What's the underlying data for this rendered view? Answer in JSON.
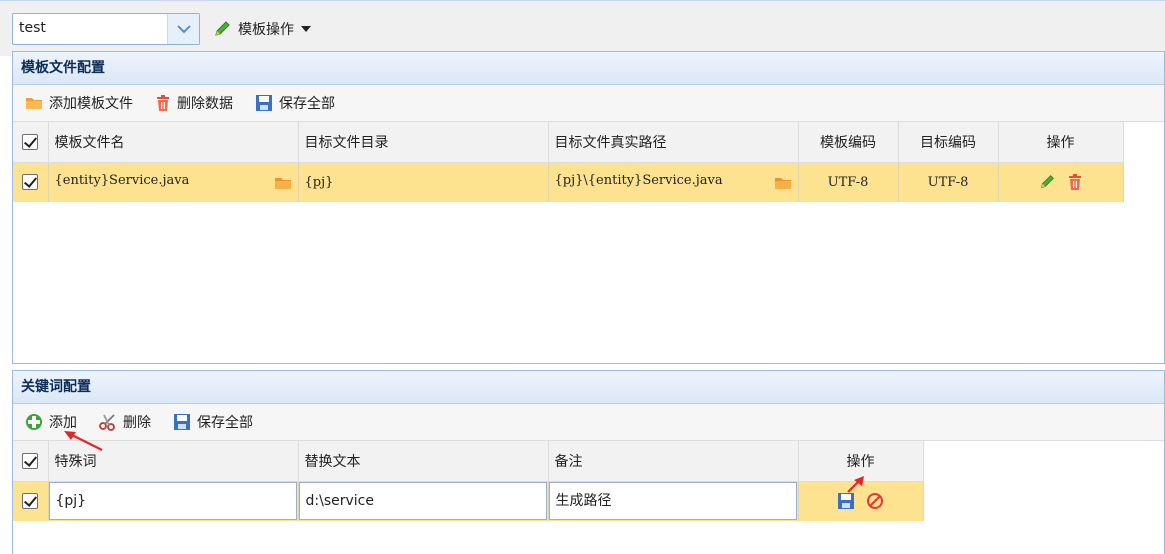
{
  "topbar": {
    "project_select_value": "test",
    "template_ops_label": "模板操作"
  },
  "template_panel": {
    "title": "模板文件配置",
    "toolbar": {
      "add_label": "添加模板文件",
      "delete_label": "删除数据",
      "save_label": "保存全部"
    },
    "columns": [
      "模板文件名",
      "目标文件目录",
      "目标文件真实路径",
      "模板编码",
      "目标编码",
      "操作"
    ],
    "rows": [
      {
        "template_file": "{entity}Service.java",
        "target_dir": "{pj}",
        "target_path": "{pj}\\{entity}Service.java",
        "template_encoding": "UTF-8",
        "target_encoding": "UTF-8"
      }
    ]
  },
  "keyword_panel": {
    "title": "关键词配置",
    "toolbar": {
      "add_label": "添加",
      "delete_label": "删除",
      "save_label": "保存全部"
    },
    "columns": [
      "特殊词",
      "替换文本",
      "备注",
      "操作"
    ],
    "rows": [
      {
        "keyword": "{pj}",
        "replacement": "d:\\service",
        "remark": "生成路径"
      }
    ]
  },
  "colors": {
    "selected_row": "#fde38f",
    "panel_border": "#9dbbe0",
    "header_bg": "#f2f2f2",
    "annotation_arrow": "#e8242b"
  },
  "icons": [
    "chevron-down-icon",
    "pencil-icon",
    "caret-down-icon",
    "folder-icon",
    "trash-icon",
    "save-icon",
    "add-icon",
    "scissors-icon",
    "cancel-icon"
  ]
}
